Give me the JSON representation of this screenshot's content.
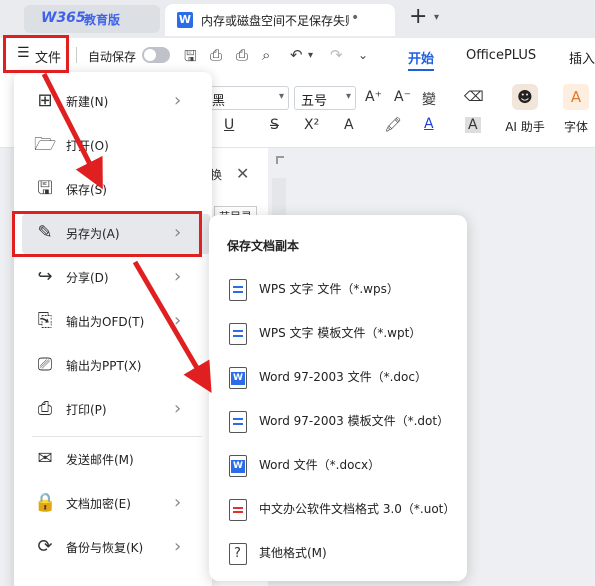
{
  "app": {
    "home_tab": {
      "brand": "W365",
      "label": "教育版"
    },
    "doc_tab": {
      "title": "内存或磁盘空间不足保存失败怎么办"
    },
    "new_tab_symbol": "+"
  },
  "toolbar": {
    "file_label": "文件",
    "autosave_label": "自动保存",
    "tabs": [
      "开始",
      "OfficePLUS",
      "插入"
    ],
    "active_tab": "开始"
  },
  "ribbon": {
    "font_name": "黑",
    "font_size": "五号",
    "ai_label": "AI 助手",
    "font_label": "字体"
  },
  "nav_panel": {
    "fragment": "换",
    "fragment2": "节目录"
  },
  "file_menu": {
    "items": [
      {
        "label": "新建(N)",
        "icon": "new-doc-icon",
        "has_submenu": true
      },
      {
        "label": "打开(O)",
        "icon": "folder-icon",
        "has_submenu": false
      },
      {
        "label": "保存(S)",
        "icon": "save-icon",
        "has_submenu": false
      },
      {
        "label": "另存为(A)",
        "icon": "save-as-icon",
        "has_submenu": true,
        "highlighted": true
      },
      {
        "label": "分享(D)",
        "icon": "share-icon",
        "has_submenu": true
      },
      {
        "label": "输出为OFD(T)",
        "icon": "ofd-icon",
        "has_submenu": true
      },
      {
        "label": "输出为PPT(X)",
        "icon": "ppt-icon",
        "has_submenu": false
      },
      {
        "label": "打印(P)",
        "icon": "print-icon",
        "has_submenu": true
      },
      {
        "label": "发送邮件(M)",
        "icon": "mail-icon",
        "has_submenu": false
      },
      {
        "label": "文档加密(E)",
        "icon": "encrypt-icon",
        "has_submenu": true
      },
      {
        "label": "备份与恢复(K)",
        "icon": "backup-icon",
        "has_submenu": true
      }
    ]
  },
  "saveas_panel": {
    "header": "保存文档副本",
    "items": [
      {
        "label": "WPS 文字 文件（*.wps）",
        "icon": "wps-doc-icon"
      },
      {
        "label": "WPS 文字 模板文件（*.wpt）",
        "icon": "wps-template-icon"
      },
      {
        "label": "Word 97-2003 文件（*.doc）",
        "icon": "word-doc-icon"
      },
      {
        "label": "Word 97-2003 模板文件（*.dot）",
        "icon": "word-template-icon"
      },
      {
        "label": "Word 文件（*.docx）",
        "icon": "word-docx-icon"
      },
      {
        "label": "中文办公软件文档格式 3.0（*.uot）",
        "icon": "uot-doc-icon"
      },
      {
        "label": "其他格式(M)",
        "icon": "other-format-icon"
      }
    ]
  },
  "colors": {
    "accent": "#1f5fe0",
    "annotation_red": "#e02020",
    "menu_highlight": "#e6e8ec"
  }
}
